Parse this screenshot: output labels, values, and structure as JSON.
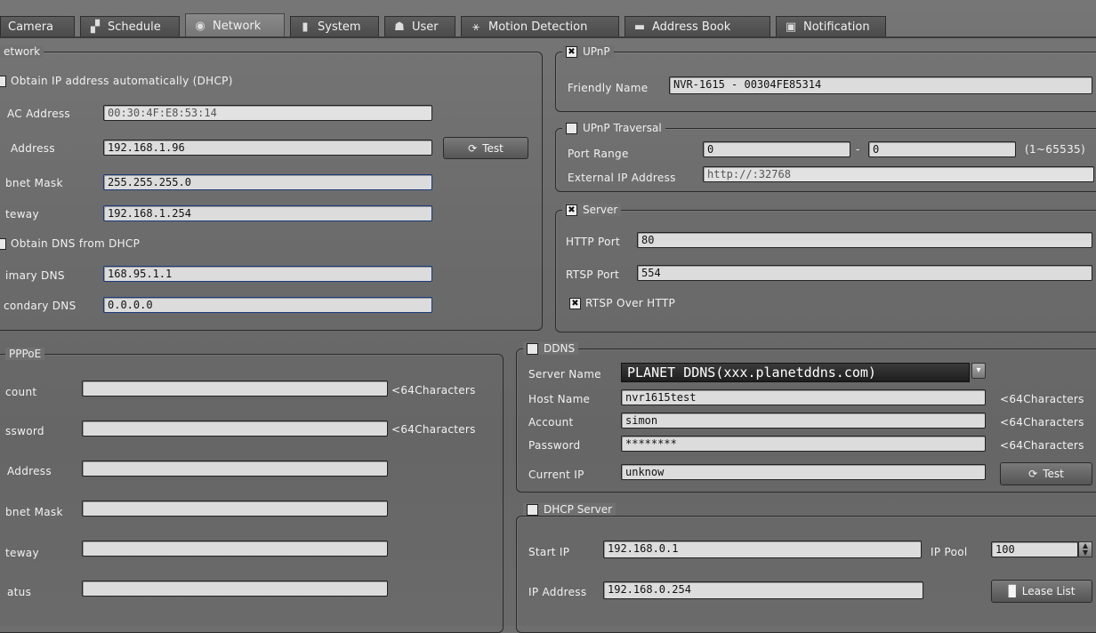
{
  "tabs": [
    {
      "label": "Camera",
      "icon": "camera-icon"
    },
    {
      "label": "Schedule",
      "icon": "schedule-icon"
    },
    {
      "label": "Network",
      "icon": "network-icon"
    },
    {
      "label": "System",
      "icon": "system-icon"
    },
    {
      "label": "User",
      "icon": "user-icon"
    },
    {
      "label": "Motion Detection",
      "icon": "motion-icon"
    },
    {
      "label": "Address Book",
      "icon": "address-book-icon"
    },
    {
      "label": "Notification",
      "icon": "notification-icon"
    }
  ],
  "network": {
    "legend": "etwork",
    "dhcp_label": "Obtain IP address automatically (DHCP)",
    "mac_label": "AC Address",
    "mac_value": "00:30:4F:E8:53:14",
    "ip_label": "Address",
    "ip_value": "192.168.1.96",
    "test_label": "Test",
    "subnet_label": "bnet Mask",
    "subnet_value": "255.255.255.0",
    "gateway_label": "teway",
    "gateway_value": "192.168.1.254",
    "dns_dhcp_label": "Obtain DNS from DHCP",
    "primary_dns_label": "imary DNS",
    "primary_dns_value": "168.95.1.1",
    "secondary_dns_label": "condary DNS",
    "secondary_dns_value": "0.0.0.0"
  },
  "upnp": {
    "legend": "UPnP",
    "checked_mark": "✖",
    "friendly_name_label": "Friendly Name",
    "friendly_name_value": "NVR-1615 - 00304FE85314"
  },
  "upnp_traversal": {
    "legend": "UPnP Traversal",
    "port_range_label": "Port Range",
    "port_from": "0",
    "dash": "-",
    "port_to": "0",
    "range_hint": "(1~65535)",
    "external_ip_label": "External IP Address",
    "external_ip_value": "http://:32768"
  },
  "server": {
    "legend": "Server",
    "checked_mark": "✖",
    "http_port_label": "HTTP Port",
    "http_port_value": "80",
    "rtsp_port_label": "RTSP Port",
    "rtsp_port_value": "554",
    "rtsp_http_label": "RTSP Over HTTP",
    "rtsp_http_mark": "✖"
  },
  "pppoe": {
    "legend": "PPPoE",
    "account_label": "count",
    "account_value": "",
    "account_hint": "<64Characters",
    "password_label": "ssword",
    "password_value": "",
    "password_hint": "<64Characters",
    "address_label": "Address",
    "address_value": "",
    "subnet_label": "bnet Mask",
    "subnet_value": "",
    "gateway_label": "teway",
    "gateway_value": "",
    "status_label": "atus",
    "status_value": ""
  },
  "ddns": {
    "legend": "DDNS",
    "server_name_label": "Server Name",
    "server_name_value": "PLANET DDNS(xxx.planetddns.com)",
    "host_name_label": "Host Name",
    "host_name_value": "nvr1615test",
    "host_hint": "<64Characters",
    "account_label": "Account",
    "account_value": "simon",
    "account_hint": "<64Characters",
    "password_label": "Password",
    "password_value": "********",
    "password_hint": "<64Characters",
    "current_ip_label": "Current IP",
    "current_ip_value": "unknow",
    "test_label": "Test"
  },
  "dhcp_server": {
    "legend": "DHCP Server",
    "start_ip_label": "Start IP",
    "start_ip_value": "192.168.0.1",
    "ip_pool_label": "IP Pool",
    "ip_pool_value": "100",
    "ip_address_label": "IP Address",
    "ip_address_value": "192.168.0.254",
    "lease_list_label": "Lease List"
  }
}
